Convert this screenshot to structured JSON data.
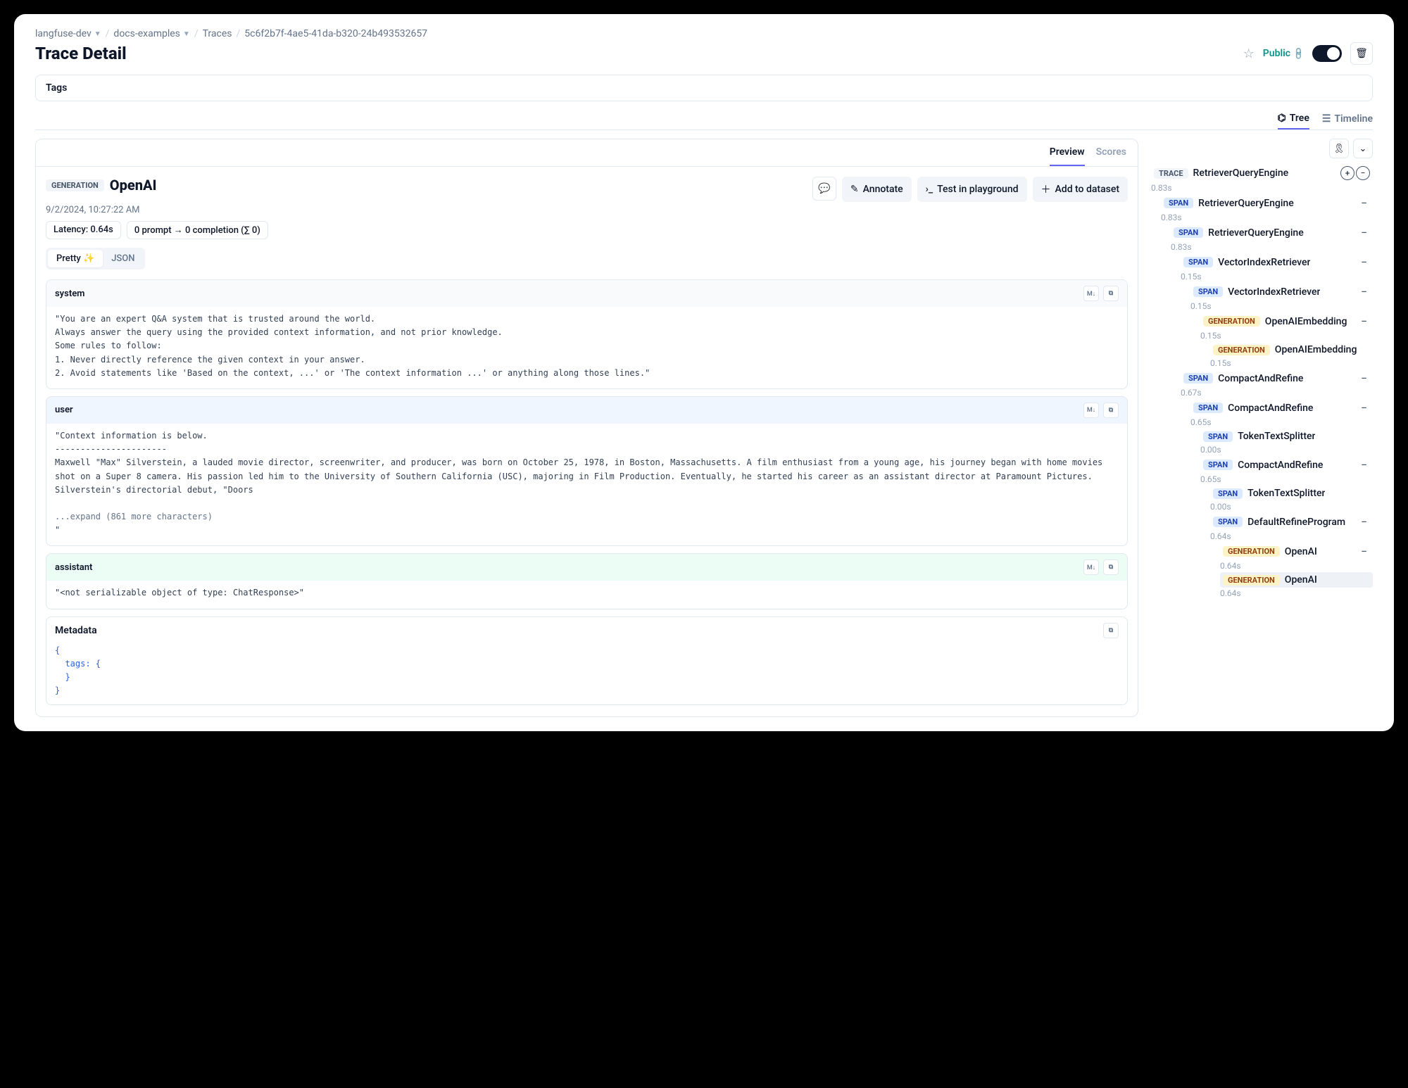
{
  "breadcrumb": {
    "project": "langfuse-dev",
    "folder": "docs-examples",
    "section": "Traces",
    "id": "5c6f2b7f-4ae5-41da-b320-24b493532657"
  },
  "title": "Trace Detail",
  "public_label": "Public",
  "tags_label": "Tags",
  "view_tabs": {
    "tree": "Tree",
    "timeline": "Timeline"
  },
  "panel_tabs": {
    "preview": "Preview",
    "scores": "Scores"
  },
  "generation": {
    "tag": "GENERATION",
    "name": "OpenAI",
    "timestamp": "9/2/2024, 10:27:22 AM",
    "latency": "Latency: 0.64s",
    "tokens": "0 prompt → 0 completion (∑ 0)"
  },
  "actions": {
    "annotate": "Annotate",
    "test": "Test in playground",
    "add_dataset": "Add to dataset"
  },
  "format": {
    "pretty": "Pretty ✨",
    "json": "JSON"
  },
  "messages": {
    "system": {
      "role": "system",
      "body": "\"You are an expert Q&A system that is trusted around the world.\nAlways answer the query using the provided context information, and not prior knowledge.\nSome rules to follow:\n1. Never directly reference the given context in your answer.\n2. Avoid statements like 'Based on the context, ...' or 'The context information ...' or anything along those lines.\""
    },
    "user": {
      "role": "user",
      "body_pre": "\"Context information is below.\n----------------------\nMaxwell \"Max\" Silverstein, a lauded movie director, screenwriter, and producer, was born on October 25, 1978, in Boston, Massachusetts. A film enthusiast from a young age, his journey began with home movies shot on a Super 8 camera. His passion led him to the University of Southern California (USC), majoring in Film Production. Eventually, he started his career as an assistant director at Paramount Pictures. Silverstein's directorial debut, \"Doors",
      "expand": "...expand (861 more characters)",
      "body_post": "\""
    },
    "assistant": {
      "role": "assistant",
      "body": "\"<not serializable object of type: ChatResponse>\""
    }
  },
  "metadata_label": "Metadata",
  "metadata_body": "{\n  tags: {\n  }\n}",
  "tree": [
    {
      "indent": 0,
      "type": "TRACE",
      "name": "RetrieverQueryEngine",
      "time": "0.83s",
      "top": true
    },
    {
      "indent": 1,
      "type": "SPAN",
      "name": "RetrieverQueryEngine",
      "time": "0.83s",
      "collapsible": true
    },
    {
      "indent": 2,
      "type": "SPAN",
      "name": "RetrieverQueryEngine",
      "time": "0.83s",
      "collapsible": true
    },
    {
      "indent": 3,
      "type": "SPAN",
      "name": "VectorIndexRetriever",
      "time": "0.15s",
      "collapsible": true
    },
    {
      "indent": 4,
      "type": "SPAN",
      "name": "VectorIndexRetriever",
      "time": "0.15s",
      "collapsible": true
    },
    {
      "indent": 5,
      "type": "GENERATION",
      "name": "OpenAIEmbedding",
      "time": "0.15s",
      "collapsible": true
    },
    {
      "indent": 6,
      "type": "GENERATION",
      "name": "OpenAIEmbedding",
      "time": "0.15s"
    },
    {
      "indent": 3,
      "type": "SPAN",
      "name": "CompactAndRefine",
      "time": "0.67s",
      "collapsible": true
    },
    {
      "indent": 4,
      "type": "SPAN",
      "name": "CompactAndRefine",
      "time": "0.65s",
      "collapsible": true
    },
    {
      "indent": 5,
      "type": "SPAN",
      "name": "TokenTextSplitter",
      "time": "0.00s"
    },
    {
      "indent": 5,
      "type": "SPAN",
      "name": "CompactAndRefine",
      "time": "0.65s",
      "collapsible": true
    },
    {
      "indent": 6,
      "type": "SPAN",
      "name": "TokenTextSplitter",
      "time": "0.00s"
    },
    {
      "indent": 6,
      "type": "SPAN",
      "name": "DefaultRefineProgram",
      "time": "0.64s",
      "collapsible": true
    },
    {
      "indent": 7,
      "type": "GENERATION",
      "name": "OpenAI",
      "time": "0.64s",
      "collapsible": true
    },
    {
      "indent": 8,
      "type": "GENERATION",
      "name": "OpenAI",
      "time": "0.64s",
      "selected": true
    }
  ]
}
